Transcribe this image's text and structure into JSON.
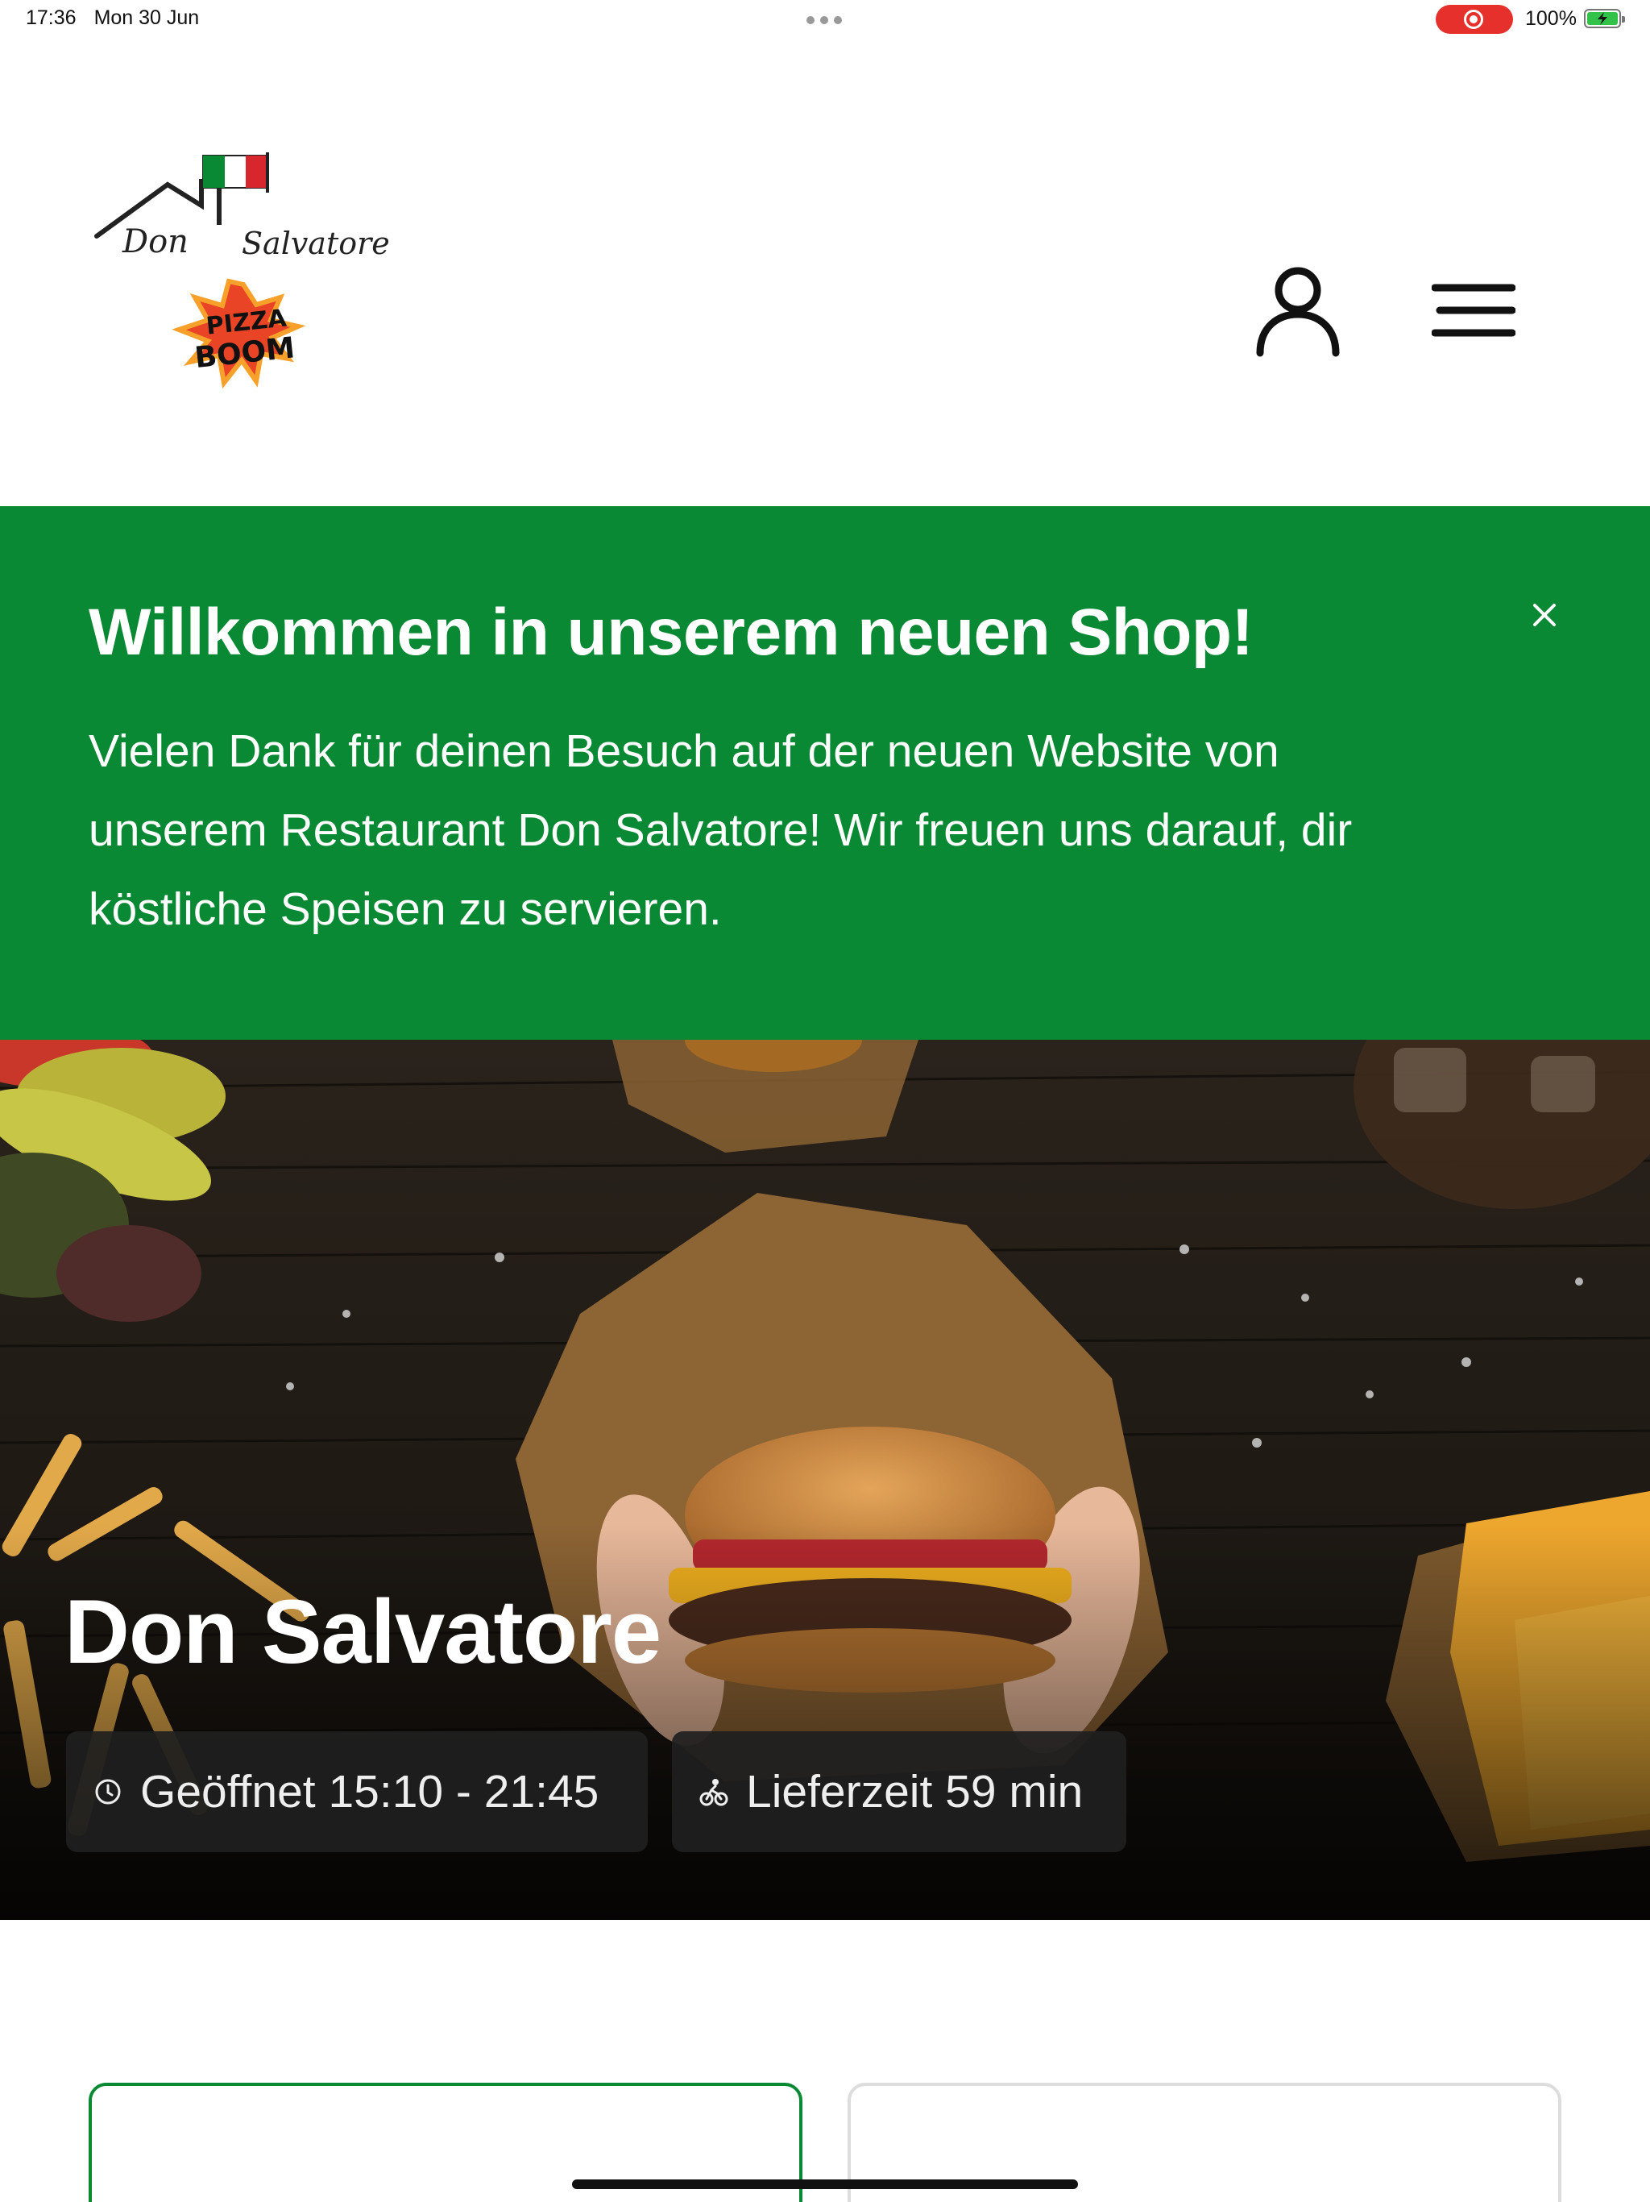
{
  "status_bar": {
    "time": "17:36",
    "date": "Mon 30 Jun",
    "battery": "100%"
  },
  "header": {
    "logo": {
      "brand": "Don Salvatore",
      "sub1": "PIZZA",
      "sub2": "BOOM"
    },
    "account_icon": "user-icon",
    "menu_icon": "menu-icon"
  },
  "banner": {
    "title": "Willkommen in unserem neuen Shop!",
    "line1": "Vielen Dank für deinen Besuch auf der neuen Website von",
    "line2": "unserem Restaurant Don Salvatore! Wir freuen uns darauf, dir",
    "line3": "köstliche Speisen zu servieren.",
    "close_icon": "close-icon",
    "bg_color": "#098933"
  },
  "hero": {
    "title": "Don Salvatore",
    "hours": "Geöffnet 15:10 - 21:45",
    "delivery": "Lieferzeit 59 min",
    "hours_icon": "clock-icon",
    "delivery_icon": "bicycle-icon"
  },
  "cards": {
    "selected_border": "#098933"
  }
}
